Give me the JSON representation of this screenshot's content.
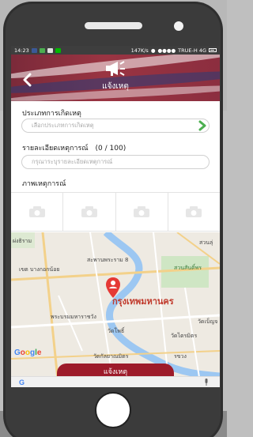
{
  "statusbar": {
    "time": "14:23",
    "speed": "147K/s",
    "carrier": "TRUE-H 4G"
  },
  "header": {
    "title": "แจ้งเหตุ"
  },
  "form": {
    "incident_type_label": "ประเภทการเกิดเหตุ",
    "incident_type_placeholder": "เลือกประเภทการเกิดเหตุ",
    "details_label": "รายละเอียดเหตุการณ์",
    "details_counter": "(0 / 100)",
    "details_placeholder": "กรุณาระบุรายละเอียดเหตุการณ์",
    "photos_label": "ภาพเหตุการณ์"
  },
  "map": {
    "labels": {
      "l1": "ผ่งธิราม",
      "l2": "สะพานพระราม 8",
      "l3": "สวนลุ่",
      "l4": "สวนสันติ์พร",
      "l5": "เขต บางกอกน้อย",
      "l6": "กรุงเทพมหานคร",
      "l7": "พระบรมมหาราชวัง",
      "l8": "วัดโพธิ์",
      "l9": "วัดไตรมิตร",
      "l10": "วัดกัลยาณมิตร",
      "l11": "รขวง",
      "l12": "วัดเบ็ญจ"
    },
    "attribution": "Google"
  },
  "submit_label": "แจ้งเหตุ",
  "colors": {
    "header": "#8c2e3f",
    "accent_green": "#4caf50",
    "submit": "#9d1b2a",
    "pin": "#e53935"
  }
}
